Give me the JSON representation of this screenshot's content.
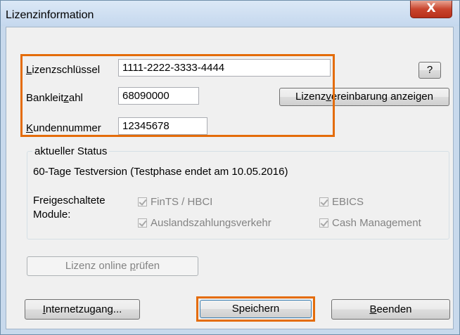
{
  "window": {
    "title": "Lizenzinformation",
    "close_glyph": "X"
  },
  "license": {
    "key_label_u": "L",
    "key_label_rest": "izenzschlüssel",
    "key_value": "1111-2222-3333-4444",
    "bank_label_pre": "Bankleit",
    "bank_label_u": "z",
    "bank_label_rest": "ahl",
    "bank_value": "68090000",
    "customer_label_u": "K",
    "customer_label_rest": "undennummer",
    "customer_value": "12345678",
    "help_label": "?",
    "agreement_pre": "Lizenz",
    "agreement_u": "v",
    "agreement_rest": "ereinbarung anzeigen"
  },
  "status": {
    "group_title": "aktueller Status",
    "text": "60-Tage Testversion (Testphase endet am 10.05.2016)",
    "modules_label_line1": "Freigeschaltete",
    "modules_label_line2": "Module:",
    "modules": [
      {
        "label": "FinTS / HBCI",
        "checked": true
      },
      {
        "label": "EBICS",
        "checked": true
      },
      {
        "label": "Auslandszahlungsverkehr",
        "checked": true
      },
      {
        "label": "Cash Management",
        "checked": true
      }
    ]
  },
  "check_online": {
    "pre": "Lizenz online ",
    "u": "p",
    "rest": "rüfen"
  },
  "footer": {
    "internet_u": "I",
    "internet_rest": "nternetzugang...",
    "save_label": "Speichern",
    "quit_u": "B",
    "quit_rest": "eenden"
  },
  "colors": {
    "highlight": "#e46c0a",
    "close_button": "#c9452e"
  }
}
